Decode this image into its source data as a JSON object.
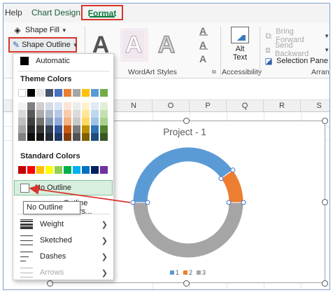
{
  "tabs": {
    "help": "Help",
    "chart_design": "Chart Design",
    "format": "Format"
  },
  "ribbon": {
    "shape_fill": "Shape Fill",
    "shape_outline": "Shape Outline",
    "wordart_letter": "A",
    "wordart_group": "WordArt Styles",
    "alt_text_line1": "Alt",
    "alt_text_line2": "Text",
    "accessibility_group": "Accessibility",
    "bring_forward": "Bring Forward",
    "send_backward": "Send Backward",
    "selection_pane": "Selection Pane",
    "arrange_group": "Arrang"
  },
  "columns": [
    "N",
    "O",
    "P",
    "Q",
    "R",
    "S"
  ],
  "menu": {
    "automatic": "Automatic",
    "theme_colors": "Theme Colors",
    "theme_top_row": [
      "#ffffff",
      "#000000",
      "#e7e6e6",
      "#44546a",
      "#4472c4",
      "#ed7d31",
      "#a5a5a5",
      "#ffc000",
      "#5b9bd5",
      "#70ad47"
    ],
    "theme_shades": [
      [
        "#f2f2f2",
        "#d9d9d9",
        "#bfbfbf",
        "#a6a6a6",
        "#808080"
      ],
      [
        "#808080",
        "#595959",
        "#404040",
        "#262626",
        "#0d0d0d"
      ],
      [
        "#d0cece",
        "#aeabab",
        "#757171",
        "#3b3838",
        "#161616"
      ],
      [
        "#d6dce5",
        "#adb9ca",
        "#8497b0",
        "#333f50",
        "#222a35"
      ],
      [
        "#dae3f3",
        "#b4c7e7",
        "#8faadc",
        "#2f5597",
        "#1f3864"
      ],
      [
        "#fbe5d6",
        "#f8cbad",
        "#f4b183",
        "#c55a11",
        "#843c0c"
      ],
      [
        "#ededed",
        "#dbdbdb",
        "#c9c9c9",
        "#7b7b7b",
        "#525252"
      ],
      [
        "#fff2cc",
        "#ffe699",
        "#ffd966",
        "#bf9000",
        "#7f6000"
      ],
      [
        "#deebf7",
        "#bdd7ee",
        "#9dc3e6",
        "#2e75b6",
        "#1f4e79"
      ],
      [
        "#e2f0d9",
        "#c5e0b4",
        "#a9d18e",
        "#548235",
        "#385723"
      ]
    ],
    "standard_colors": "Standard Colors",
    "standard_row": [
      "#c00000",
      "#ff0000",
      "#ffc000",
      "#ffff00",
      "#92d050",
      "#00b050",
      "#00b0f0",
      "#0070c0",
      "#002060",
      "#7030a0"
    ],
    "no_outline": "No Outline",
    "more_colors": "Outline Colors...",
    "tooltip": "No Outline",
    "weight": "Weight",
    "sketched": "Sketched",
    "dashes": "Dashes",
    "arrows": "Arrows"
  },
  "chart_data": {
    "type": "pie",
    "title": "Project - 1",
    "categories": [
      "1",
      "2",
      "3"
    ],
    "values": [
      40,
      10,
      50
    ],
    "colors": [
      "#5b9bd5",
      "#ed7d31",
      "#a5a5a5"
    ],
    "donut": true,
    "legend_position": "bottom"
  },
  "accent": {
    "annotation_red": "#d9342b",
    "excel_green": "#107c41"
  }
}
